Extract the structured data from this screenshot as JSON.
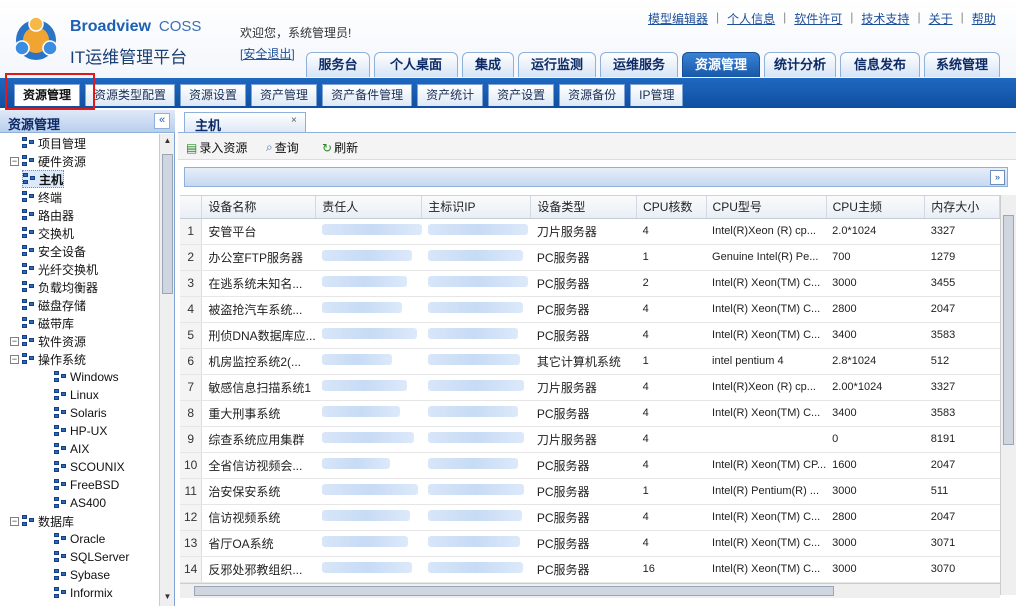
{
  "header": {
    "brand": "Broadview",
    "brand_suffix": "COSS",
    "app_name": "IT运维管理平台",
    "welcome": "欢迎您，系统管理员!",
    "logout": "[安全退出]",
    "top_links": [
      "模型编辑器",
      "个人信息",
      "软件许可",
      "技术支持",
      "关于",
      "帮助"
    ],
    "main_tabs": [
      "服务台",
      "个人桌面",
      "集成",
      "运行监测",
      "运维服务",
      "资源管理",
      "统计分析",
      "信息发布",
      "系统管理"
    ],
    "active_main_tab": "资源管理"
  },
  "subnav": {
    "tabs": [
      "资源管理",
      "资源类型配置",
      "资源设置",
      "资产管理",
      "资产备件管理",
      "资产统计",
      "资产设置",
      "资源备份",
      "IP管理"
    ],
    "active": "资源管理"
  },
  "left_panel": {
    "title": "资源管理",
    "collapse_glyph": "«",
    "tree": [
      {
        "label": "项目管理",
        "level": 1,
        "toggle": ""
      },
      {
        "label": "硬件资源",
        "level": 0,
        "toggle": "−"
      },
      {
        "label": "主机",
        "level": 1,
        "toggle": "",
        "selected": true
      },
      {
        "label": "终端",
        "level": 1,
        "toggle": ""
      },
      {
        "label": "路由器",
        "level": 1,
        "toggle": ""
      },
      {
        "label": "交换机",
        "level": 1,
        "toggle": ""
      },
      {
        "label": "安全设备",
        "level": 1,
        "toggle": ""
      },
      {
        "label": "光纤交换机",
        "level": 1,
        "toggle": ""
      },
      {
        "label": "负载均衡器",
        "level": 1,
        "toggle": ""
      },
      {
        "label": "磁盘存储",
        "level": 1,
        "toggle": ""
      },
      {
        "label": "磁带库",
        "level": 1,
        "toggle": ""
      },
      {
        "label": "软件资源",
        "level": 0,
        "toggle": "−"
      },
      {
        "label": "操作系统",
        "level": 1,
        "toggle": "−"
      },
      {
        "label": "Windows",
        "level": 2,
        "toggle": ""
      },
      {
        "label": "Linux",
        "level": 2,
        "toggle": ""
      },
      {
        "label": "Solaris",
        "level": 2,
        "toggle": ""
      },
      {
        "label": "HP-UX",
        "level": 2,
        "toggle": ""
      },
      {
        "label": "AIX",
        "level": 2,
        "toggle": ""
      },
      {
        "label": "SCOUNIX",
        "level": 2,
        "toggle": ""
      },
      {
        "label": "FreeBSD",
        "level": 2,
        "toggle": ""
      },
      {
        "label": "AS400",
        "level": 2,
        "toggle": ""
      },
      {
        "label": "数据库",
        "level": 1,
        "toggle": "−"
      },
      {
        "label": "Oracle",
        "level": 2,
        "toggle": ""
      },
      {
        "label": "SQLServer",
        "level": 2,
        "toggle": ""
      },
      {
        "label": "Sybase",
        "level": 2,
        "toggle": ""
      },
      {
        "label": "Informix",
        "level": 2,
        "toggle": ""
      }
    ]
  },
  "content": {
    "tab_title": "主机",
    "tab_close": "×",
    "toolbar": {
      "add": "录入资源",
      "query": "查询",
      "refresh": "刷新"
    },
    "expand_glyph": "»",
    "columns": [
      "设备名称",
      "责任人",
      "主标识IP",
      "设备类型",
      "CPU核数",
      "CPU型号",
      "CPU主频",
      "内存大小"
    ],
    "rows": [
      {
        "n": "1",
        "name": "安管平台",
        "type": "刀片服务器",
        "cores": "4",
        "model": "Intel(R)Xeon (R) cp...",
        "freq": "2.0*1024",
        "mem": "3327"
      },
      {
        "n": "2",
        "name": "办公室FTP服务器",
        "type": "PC服务器",
        "cores": "1",
        "model": "Genuine Intel(R) Pe...",
        "freq": "700",
        "mem": "1279"
      },
      {
        "n": "3",
        "name": "在逃系统未知名...",
        "type": "PC服务器",
        "cores": "2",
        "model": "Intel(R) Xeon(TM) C...",
        "freq": "3000",
        "mem": "3455"
      },
      {
        "n": "4",
        "name": "被盗抢汽车系统...",
        "type": "PC服务器",
        "cores": "4",
        "model": "Intel(R) Xeon(TM) C...",
        "freq": "2800",
        "mem": "2047"
      },
      {
        "n": "5",
        "name": "刑侦DNA数据库应...",
        "type": "PC服务器",
        "cores": "4",
        "model": "Intel(R) Xeon(TM) C...",
        "freq": "3400",
        "mem": "3583"
      },
      {
        "n": "6",
        "name": "机房监控系统2(...",
        "type": "其它计算机系统",
        "cores": "1",
        "model": "intel pentium 4",
        "freq": "2.8*1024",
        "mem": "512"
      },
      {
        "n": "7",
        "name": "敏感信息扫描系统1",
        "type": "刀片服务器",
        "cores": "4",
        "model": "Intel(R)Xeon (R) cp...",
        "freq": "2.00*1024",
        "mem": "3327"
      },
      {
        "n": "8",
        "name": "重大刑事系统",
        "type": "PC服务器",
        "cores": "4",
        "model": "Intel(R) Xeon(TM) C...",
        "freq": "3400",
        "mem": "3583"
      },
      {
        "n": "9",
        "name": "综查系统应用集群",
        "type": "刀片服务器",
        "cores": "4",
        "model": "",
        "freq": "0",
        "mem": "8191"
      },
      {
        "n": "10",
        "name": "全省信访视频会...",
        "type": "PC服务器",
        "cores": "4",
        "model": "Intel(R) Xeon(TM) CP...",
        "freq": "1600",
        "mem": "2047"
      },
      {
        "n": "11",
        "name": "治安保安系统",
        "type": "PC服务器",
        "cores": "1",
        "model": "Intel(R) Pentium(R) ...",
        "freq": "3000",
        "mem": "511"
      },
      {
        "n": "12",
        "name": "信访视频系统",
        "type": "PC服务器",
        "cores": "4",
        "model": "Intel(R) Xeon(TM) C...",
        "freq": "2800",
        "mem": "2047"
      },
      {
        "n": "13",
        "name": "省厅OA系统",
        "type": "PC服务器",
        "cores": "4",
        "model": "Intel(R) Xeon(TM) C...",
        "freq": "3000",
        "mem": "3071"
      },
      {
        "n": "14",
        "name": "反邪处邪教组织...",
        "type": "PC服务器",
        "cores": "16",
        "model": "Intel(R) Xeon(TM) C...",
        "freq": "3000",
        "mem": "3070"
      }
    ]
  }
}
